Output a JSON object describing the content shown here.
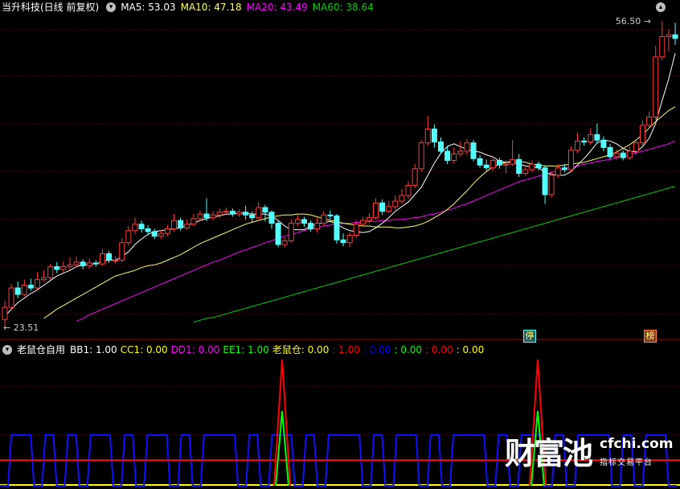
{
  "header": {
    "stock_title": "当升科技(日线 前复权)",
    "ma5": "MA5: 53.03",
    "ma10": "MA10: 47.18",
    "ma20": "MA20: 43.49",
    "ma60": "MA60: 38.64"
  },
  "indicator": {
    "name": "老鼠仓自用",
    "items": [
      {
        "text": "BB1: 1.00",
        "color": "#ffffff"
      },
      {
        "text": "CC1: 0.00",
        "color": "#ffff00"
      },
      {
        "text": "DD1: 0.00",
        "color": "#ff00ff"
      },
      {
        "text": "EE1: 1.00",
        "color": "#00ff00"
      },
      {
        "text": "老鼠仓: 0.00",
        "color": "#ffff00"
      },
      {
        "text": ": 1.00",
        "color": "#ff0000"
      },
      {
        "text": ": 0.00",
        "color": "#0000ff"
      },
      {
        "text": ": 0.00",
        "color": "#00ff00"
      },
      {
        "text": ": 0.00",
        "color": "#ff0000"
      },
      {
        "text": ": 0.00",
        "color": "#ffff00"
      }
    ]
  },
  "badges": {
    "stop": "停",
    "list": "榜"
  },
  "watermark": {
    "brand": "财富池",
    "url": "cfchi.com",
    "tagline": "指标交易平台"
  },
  "colors": {
    "up": "#ff3b3b",
    "down": "#54ffff",
    "ma5": "#ffffff",
    "ma10": "#ffff66",
    "ma20": "#ff00ff",
    "ma60": "#00d000",
    "grid": "#7a0000",
    "text_red": "#ff3b3b"
  },
  "chart_data": [
    {
      "type": "candlestick",
      "price_range": [
        23.51,
        56.5
      ],
      "high_label": "56.50",
      "low_label": "23.51",
      "candles": [
        [
          24.2,
          25.5,
          26.2,
          23.51
        ],
        [
          25.5,
          27.6,
          28.0,
          25.2
        ],
        [
          27.6,
          26.9,
          28.3,
          26.5
        ],
        [
          26.9,
          27.9,
          28.5,
          26.7
        ],
        [
          27.9,
          27.6,
          28.6,
          27.3
        ],
        [
          27.6,
          28.5,
          29.3,
          27.4
        ],
        [
          28.5,
          28.7,
          29.5,
          28.3
        ],
        [
          28.7,
          29.9,
          30.2,
          28.5
        ],
        [
          29.9,
          29.6,
          30.4,
          29.2
        ],
        [
          29.6,
          29.9,
          30.5,
          29.3
        ],
        [
          29.9,
          30.1,
          30.9,
          29.6
        ],
        [
          30.1,
          30.4,
          31.0,
          29.8
        ],
        [
          30.4,
          30.0,
          30.7,
          29.6
        ],
        [
          30.0,
          30.3,
          30.8,
          29.7
        ],
        [
          30.3,
          30.2,
          30.6,
          29.9
        ],
        [
          30.2,
          31.3,
          31.8,
          30.0
        ],
        [
          31.3,
          30.6,
          31.6,
          30.3
        ],
        [
          30.6,
          30.6,
          31.0,
          30.2
        ],
        [
          30.6,
          32.5,
          33.0,
          30.4
        ],
        [
          32.5,
          33.8,
          34.3,
          32.2
        ],
        [
          33.8,
          34.5,
          35.2,
          33.4
        ],
        [
          34.5,
          34.0,
          34.9,
          33.6
        ],
        [
          34.0,
          33.7,
          34.4,
          33.3
        ],
        [
          33.7,
          33.2,
          34.0,
          32.9
        ],
        [
          33.2,
          33.5,
          33.9,
          32.9
        ],
        [
          33.5,
          34.0,
          34.4,
          33.2
        ],
        [
          34.0,
          34.9,
          35.6,
          33.7
        ],
        [
          34.9,
          34.1,
          35.2,
          33.8
        ],
        [
          34.1,
          34.5,
          35.0,
          33.9
        ],
        [
          34.5,
          35.1,
          35.6,
          34.3
        ],
        [
          35.1,
          35.6,
          36.0,
          34.9
        ],
        [
          35.6,
          35.2,
          37.3,
          34.8
        ],
        [
          35.2,
          35.5,
          35.9,
          34.9
        ],
        [
          35.5,
          35.8,
          36.2,
          35.2
        ],
        [
          35.8,
          35.9,
          36.3,
          35.5
        ],
        [
          35.9,
          35.6,
          36.2,
          35.3
        ],
        [
          35.6,
          35.8,
          36.1,
          35.3
        ],
        [
          35.8,
          35.5,
          36.5,
          35.0
        ],
        [
          35.5,
          35.2,
          35.9,
          34.7
        ],
        [
          35.2,
          36.3,
          36.9,
          34.8
        ],
        [
          36.3,
          35.8,
          36.6,
          34.8
        ],
        [
          35.8,
          34.6,
          36.0,
          34.0
        ],
        [
          34.6,
          32.3,
          34.9,
          32.0
        ],
        [
          32.3,
          32.7,
          33.1,
          32.0
        ],
        [
          32.7,
          34.6,
          35.0,
          32.5
        ],
        [
          34.6,
          35.0,
          35.5,
          34.3
        ],
        [
          35.0,
          34.6,
          35.3,
          34.2
        ],
        [
          34.6,
          34.0,
          34.9,
          33.7
        ],
        [
          34.0,
          34.6,
          35.2,
          33.6
        ],
        [
          34.6,
          35.5,
          35.9,
          34.3
        ],
        [
          35.5,
          35.4,
          36.0,
          35.0
        ],
        [
          35.4,
          32.8,
          35.6,
          32.4
        ],
        [
          32.8,
          32.5,
          33.5,
          32.1
        ],
        [
          32.5,
          33.3,
          33.6,
          32.0
        ],
        [
          33.3,
          34.5,
          34.9,
          33.0
        ],
        [
          34.5,
          34.9,
          35.3,
          34.2
        ],
        [
          34.9,
          35.2,
          35.7,
          34.6
        ],
        [
          35.2,
          36.8,
          37.3,
          35.0
        ],
        [
          36.8,
          35.9,
          37.2,
          35.5
        ],
        [
          35.9,
          36.4,
          37.0,
          35.7
        ],
        [
          36.4,
          37.0,
          37.6,
          36.1
        ],
        [
          37.0,
          37.6,
          38.3,
          36.7
        ],
        [
          37.6,
          38.7,
          39.2,
          37.3
        ],
        [
          38.7,
          40.5,
          41.0,
          38.4
        ],
        [
          40.5,
          43.3,
          43.6,
          40.2
        ],
        [
          43.3,
          44.8,
          46.2,
          43.0
        ],
        [
          44.8,
          43.4,
          45.3,
          42.8
        ],
        [
          43.4,
          42.4,
          43.9,
          42.1
        ],
        [
          42.4,
          41.4,
          43.0,
          41.0
        ],
        [
          41.4,
          42.1,
          42.8,
          41.1
        ],
        [
          42.1,
          42.4,
          43.5,
          41.8
        ],
        [
          42.4,
          43.3,
          43.7,
          42.0
        ],
        [
          43.3,
          41.6,
          43.6,
          41.3
        ],
        [
          41.6,
          40.9,
          42.0,
          40.6
        ],
        [
          40.9,
          40.6,
          41.5,
          40.3
        ],
        [
          40.6,
          41.4,
          41.9,
          40.2
        ],
        [
          41.4,
          40.9,
          41.7,
          40.5
        ],
        [
          40.9,
          41.0,
          41.4,
          40.0
        ],
        [
          41.0,
          41.5,
          43.6,
          40.8
        ],
        [
          41.5,
          40.0,
          42.1,
          39.6
        ],
        [
          40.0,
          40.4,
          40.9,
          39.7
        ],
        [
          40.4,
          41.0,
          41.4,
          40.1
        ],
        [
          41.0,
          40.6,
          41.3,
          40.3
        ],
        [
          40.6,
          37.7,
          40.9,
          36.7
        ],
        [
          37.7,
          39.8,
          40.2,
          37.4
        ],
        [
          39.8,
          40.6,
          41.0,
          39.5
        ],
        [
          40.6,
          40.4,
          41.0,
          40.1
        ],
        [
          40.4,
          42.5,
          42.9,
          40.2
        ],
        [
          42.5,
          43.5,
          44.4,
          42.2
        ],
        [
          43.5,
          43.4,
          43.9,
          43.0
        ],
        [
          43.4,
          44.2,
          44.9,
          43.1
        ],
        [
          44.2,
          43.6,
          45.4,
          43.2
        ],
        [
          43.6,
          42.8,
          44.0,
          42.4
        ],
        [
          42.8,
          41.8,
          43.2,
          41.5
        ],
        [
          41.8,
          42.2,
          42.6,
          41.5
        ],
        [
          42.2,
          41.7,
          42.5,
          41.4
        ],
        [
          41.7,
          42.4,
          42.9,
          41.4
        ],
        [
          42.4,
          43.3,
          43.7,
          42.1
        ],
        [
          43.3,
          45.2,
          45.7,
          43.0
        ],
        [
          45.2,
          46.1,
          46.7,
          44.9
        ],
        [
          46.1,
          52.6,
          53.8,
          45.8
        ],
        [
          52.6,
          54.8,
          56.5,
          52.2
        ],
        [
          54.8,
          55.0,
          55.6,
          53.2
        ],
        [
          55.0,
          54.6,
          56.3,
          53.9
        ]
      ],
      "ma": {
        "MA5": [
          24.5,
          25.3,
          26.0,
          26.5,
          27.0,
          27.4,
          27.9,
          28.4,
          28.9,
          29.2,
          29.5,
          29.9,
          30.1,
          30.2,
          30.2,
          30.5,
          30.6,
          30.6,
          31.0,
          31.5,
          32.3,
          32.9,
          33.4,
          33.7,
          33.8,
          33.9,
          34.0,
          34.1,
          34.4,
          34.6,
          34.9,
          35.1,
          35.3,
          35.4,
          35.6,
          35.6,
          35.7,
          35.7,
          35.6,
          35.6,
          35.6,
          35.4,
          34.9,
          34.3,
          33.9,
          33.9,
          33.9,
          34.3,
          34.5,
          34.7,
          34.8,
          34.5,
          34.1,
          33.8,
          33.7,
          33.6,
          33.7,
          34.1,
          34.6,
          35.2,
          35.9,
          36.4,
          36.9,
          37.7,
          38.5,
          39.8,
          41.1,
          42.2,
          42.9,
          43.2,
          42.9,
          42.6,
          42.4,
          42.3,
          42.0,
          41.8,
          41.3,
          41.2,
          41.2,
          41.0,
          40.8,
          40.7,
          40.6,
          40.1,
          39.9,
          39.8,
          39.8,
          40.2,
          40.9,
          41.6,
          42.4,
          43.3,
          43.6,
          43.5,
          43.2,
          42.7,
          42.4,
          42.3,
          42.9,
          43.8,
          45.4,
          47.9,
          50.2,
          53.0
        ],
        "MA10": [
          24.3,
          24.8,
          25.3,
          25.7,
          26.1,
          26.5,
          26.9,
          27.3,
          27.7,
          28.1,
          28.5,
          28.9,
          29.1,
          29.3,
          29.5,
          29.8,
          30.0,
          30.1,
          30.3,
          30.6,
          30.9,
          31.2,
          31.6,
          32.0,
          32.4,
          32.7,
          33.0,
          33.3,
          33.6,
          33.9,
          34.2,
          34.5,
          34.7,
          34.9,
          35.1,
          35.3,
          35.4,
          35.5,
          35.5,
          35.6,
          35.6,
          35.5,
          35.3,
          35.1,
          34.9,
          34.8,
          34.6,
          34.5,
          34.4,
          34.3,
          34.3,
          34.2,
          34.2,
          34.2,
          34.1,
          34.1,
          34.2,
          34.3,
          34.5,
          34.8,
          35.2,
          35.6,
          36.1,
          36.7,
          37.4,
          38.1,
          38.9,
          39.6,
          40.2,
          40.7,
          41.0,
          41.2,
          41.3,
          41.3,
          41.2,
          41.0,
          40.9,
          40.8,
          40.8,
          40.8,
          40.9,
          41.0,
          41.1,
          41.2,
          41.4,
          41.6,
          41.8,
          42.0,
          42.3,
          42.7,
          43.1,
          43.6,
          44.2,
          44.9,
          45.6,
          46.2,
          46.8,
          47.2
        ],
        "MA20": [
          24.0,
          24.3,
          24.7,
          25.0,
          25.3,
          25.6,
          25.9,
          26.2,
          26.5,
          26.8,
          27.1,
          27.4,
          27.7,
          28.0,
          28.3,
          28.6,
          28.9,
          29.2,
          29.5,
          29.8,
          30.1,
          30.4,
          30.6,
          30.9,
          31.2,
          31.5,
          31.7,
          32.0,
          32.2,
          32.5,
          32.7,
          33.0,
          33.2,
          33.4,
          33.6,
          33.8,
          34.0,
          34.1,
          34.3,
          34.4,
          34.5,
          34.6,
          34.6,
          34.7,
          34.7,
          34.8,
          34.8,
          34.9,
          34.9,
          35.0,
          35.0,
          35.1,
          35.2,
          35.3,
          35.5,
          35.6,
          35.8,
          36.0,
          36.2,
          36.5,
          36.7,
          37.0,
          37.3,
          37.6,
          37.9,
          38.2,
          38.5,
          38.8,
          39.1,
          39.3,
          39.5,
          39.7,
          39.9,
          40.1,
          40.3,
          40.5,
          40.7,
          40.8,
          41.0,
          41.1,
          41.3,
          41.4,
          41.5,
          41.7,
          41.8,
          42.0,
          42.2,
          42.4,
          42.6,
          42.8,
          43.0,
          43.2,
          43.5
        ],
        "MA60": [
          23.9,
          24.1,
          24.3,
          24.4,
          24.6,
          24.8,
          25.0,
          25.2,
          25.4,
          25.6,
          25.8,
          26.0,
          26.2,
          26.4,
          26.6,
          26.8,
          27.0,
          27.2,
          27.4,
          27.6,
          27.8,
          28.0,
          28.2,
          28.4,
          28.6,
          28.8,
          29.0,
          29.2,
          29.4,
          29.6,
          29.8,
          30.0,
          30.2,
          30.4,
          30.6,
          30.8,
          31.0,
          31.2,
          31.4,
          31.6,
          31.8,
          32.0,
          32.2,
          32.4,
          32.6,
          32.8,
          33.0,
          33.2,
          33.4,
          33.6,
          33.8,
          34.0,
          34.2,
          34.4,
          34.6,
          34.8,
          35.0,
          35.2,
          35.4,
          35.6,
          35.8,
          36.0,
          36.2,
          36.4,
          36.6,
          36.8,
          37.0,
          37.2,
          37.4,
          37.6,
          37.8,
          38.0,
          38.2,
          38.4,
          38.6
        ]
      }
    },
    {
      "type": "line",
      "name": "老鼠仓自用",
      "ylim": [
        0,
        1
      ],
      "series": [
        {
          "name": "BB1",
          "color": "#ffffff",
          "value": 1.0
        },
        {
          "name": "CC1",
          "color": "#ffff00",
          "value": 0.0
        },
        {
          "name": "DD1",
          "color": "#ff00ff",
          "value": 0.0
        },
        {
          "name": "EE1",
          "color": "#00ff00",
          "value": 1.0
        },
        {
          "name": "老鼠仓",
          "color": "#ffff00",
          "value": 0.0
        }
      ],
      "blue_wave": [
        0,
        1,
        1,
        0,
        1,
        0,
        1,
        0,
        1,
        1,
        0,
        1,
        0,
        1,
        1,
        0,
        1,
        0,
        1,
        1,
        1,
        0,
        1,
        0,
        1,
        1,
        0,
        1,
        0,
        1,
        1,
        1,
        0,
        1,
        0,
        1,
        1,
        0,
        1,
        0,
        1,
        1,
        1,
        0,
        1,
        0,
        1,
        1,
        0,
        1,
        0,
        1,
        1,
        1,
        0,
        1,
        0,
        1,
        1,
        0
      ],
      "red_spikes": [
        351,
        669
      ],
      "red_level": 0.2
    }
  ]
}
